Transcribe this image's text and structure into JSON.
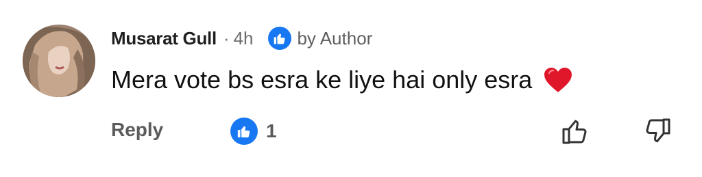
{
  "comment": {
    "author": "Musarat Gull",
    "separator": "·",
    "time": "4h",
    "liked_by_label": "by Author",
    "text": "Mera vote bs esra ke liye hai only esra",
    "emoji": "heart-emoji"
  },
  "actions": {
    "reply_label": "Reply",
    "like_count": "1"
  },
  "colors": {
    "accent": "#1877f2",
    "heart": "#e0172b"
  },
  "icons": {
    "liked_by": "thumbs-up-icon",
    "like_count": "thumbs-up-icon",
    "like_button": "thumbs-up-outline-icon",
    "dislike_button": "thumbs-down-outline-icon"
  }
}
